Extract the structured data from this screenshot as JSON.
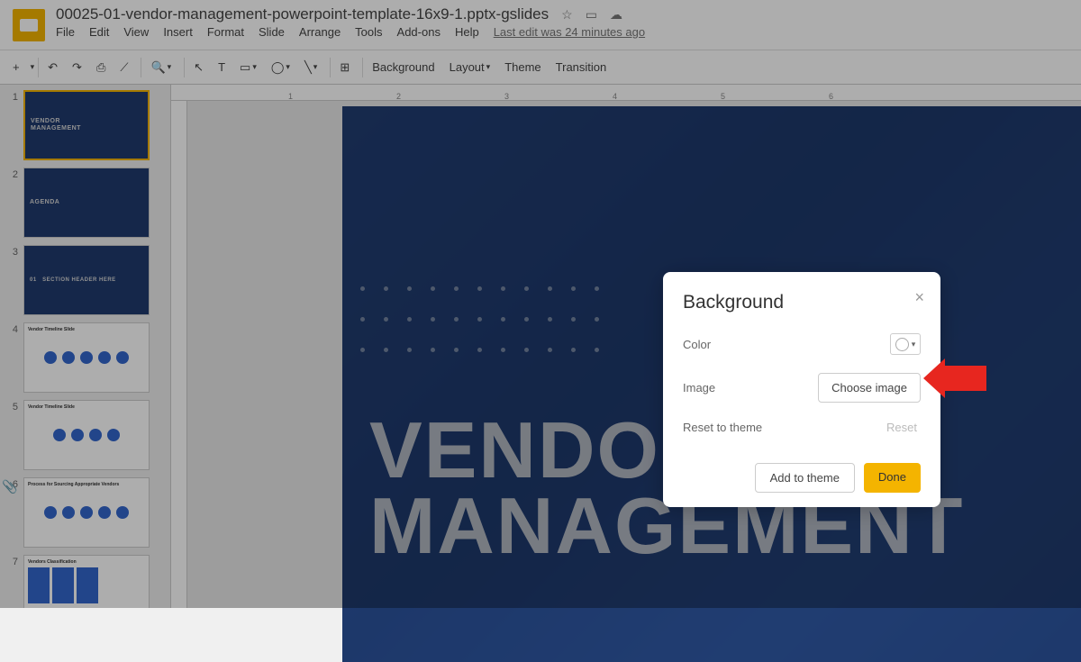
{
  "header": {
    "doc_title": "00025-01-vendor-management-powerpoint-template-16x9-1.pptx-gslides",
    "star_icon": "☆",
    "move_icon": "▭",
    "cloud_icon": "☁",
    "menus": [
      "File",
      "Edit",
      "View",
      "Insert",
      "Format",
      "Slide",
      "Arrange",
      "Tools",
      "Add-ons",
      "Help"
    ],
    "last_edit": "Last edit was 24 minutes ago"
  },
  "toolbar": {
    "new_slide": "+",
    "undo": "↶",
    "redo": "↷",
    "print": "⎙",
    "paint": "⟋",
    "zoom": "🔍",
    "select": "↖",
    "textbox": "T",
    "image": "▭",
    "shape": "◯",
    "line": "╲",
    "comment": "⊞",
    "background_btn": "Background",
    "layout_btn": "Layout",
    "theme_btn": "Theme",
    "transition_btn": "Transition"
  },
  "ruler": {
    "marks": [
      "1",
      "2",
      "3",
      "4",
      "5",
      "6"
    ]
  },
  "thumbnails": [
    {
      "num": "1",
      "type": "dark",
      "title": "VENDOR\nMANAGEMENT"
    },
    {
      "num": "2",
      "type": "dark",
      "title": "AGENDA"
    },
    {
      "num": "3",
      "type": "dark",
      "title": "01   SECTION HEADER HERE"
    },
    {
      "num": "4",
      "type": "light",
      "title": "Vendor Timeline Slide",
      "chart": "nodes"
    },
    {
      "num": "5",
      "type": "light",
      "title": "Vendor Timeline Slide",
      "chart": "nodes"
    },
    {
      "num": "6",
      "type": "light",
      "title": "Process for Sourcing Appropriate Vendors",
      "chart": "circles"
    },
    {
      "num": "7",
      "type": "light",
      "title": "Vendors Classification",
      "chart": "boxes"
    }
  ],
  "slide": {
    "main_title_line1": "VENDOR",
    "main_title_line2": "MANAGEMENT"
  },
  "dialog": {
    "title": "Background",
    "color_label": "Color",
    "image_label": "Image",
    "choose_image_btn": "Choose image",
    "reset_label": "Reset to theme",
    "reset_btn": "Reset",
    "add_to_theme_btn": "Add to theme",
    "done_btn": "Done",
    "close": "×"
  }
}
